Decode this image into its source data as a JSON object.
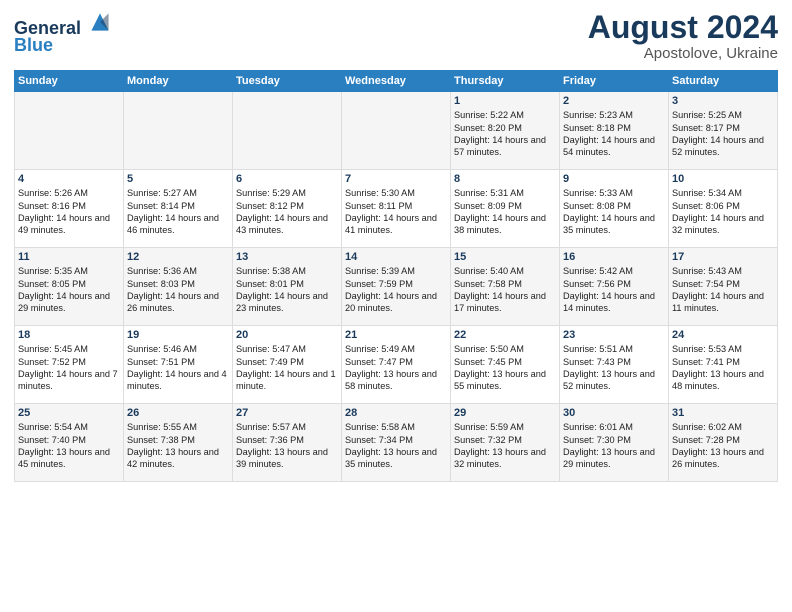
{
  "header": {
    "logo_line1": "General",
    "logo_line2": "Blue",
    "month": "August 2024",
    "location": "Apostolove, Ukraine"
  },
  "days_of_week": [
    "Sunday",
    "Monday",
    "Tuesday",
    "Wednesday",
    "Thursday",
    "Friday",
    "Saturday"
  ],
  "weeks": [
    [
      {
        "day": "",
        "content": ""
      },
      {
        "day": "",
        "content": ""
      },
      {
        "day": "",
        "content": ""
      },
      {
        "day": "",
        "content": ""
      },
      {
        "day": "1",
        "content": "Sunrise: 5:22 AM\nSunset: 8:20 PM\nDaylight: 14 hours\nand 57 minutes."
      },
      {
        "day": "2",
        "content": "Sunrise: 5:23 AM\nSunset: 8:18 PM\nDaylight: 14 hours\nand 54 minutes."
      },
      {
        "day": "3",
        "content": "Sunrise: 5:25 AM\nSunset: 8:17 PM\nDaylight: 14 hours\nand 52 minutes."
      }
    ],
    [
      {
        "day": "4",
        "content": "Sunrise: 5:26 AM\nSunset: 8:16 PM\nDaylight: 14 hours\nand 49 minutes."
      },
      {
        "day": "5",
        "content": "Sunrise: 5:27 AM\nSunset: 8:14 PM\nDaylight: 14 hours\nand 46 minutes."
      },
      {
        "day": "6",
        "content": "Sunrise: 5:29 AM\nSunset: 8:12 PM\nDaylight: 14 hours\nand 43 minutes."
      },
      {
        "day": "7",
        "content": "Sunrise: 5:30 AM\nSunset: 8:11 PM\nDaylight: 14 hours\nand 41 minutes."
      },
      {
        "day": "8",
        "content": "Sunrise: 5:31 AM\nSunset: 8:09 PM\nDaylight: 14 hours\nand 38 minutes."
      },
      {
        "day": "9",
        "content": "Sunrise: 5:33 AM\nSunset: 8:08 PM\nDaylight: 14 hours\nand 35 minutes."
      },
      {
        "day": "10",
        "content": "Sunrise: 5:34 AM\nSunset: 8:06 PM\nDaylight: 14 hours\nand 32 minutes."
      }
    ],
    [
      {
        "day": "11",
        "content": "Sunrise: 5:35 AM\nSunset: 8:05 PM\nDaylight: 14 hours\nand 29 minutes."
      },
      {
        "day": "12",
        "content": "Sunrise: 5:36 AM\nSunset: 8:03 PM\nDaylight: 14 hours\nand 26 minutes."
      },
      {
        "day": "13",
        "content": "Sunrise: 5:38 AM\nSunset: 8:01 PM\nDaylight: 14 hours\nand 23 minutes."
      },
      {
        "day": "14",
        "content": "Sunrise: 5:39 AM\nSunset: 7:59 PM\nDaylight: 14 hours\nand 20 minutes."
      },
      {
        "day": "15",
        "content": "Sunrise: 5:40 AM\nSunset: 7:58 PM\nDaylight: 14 hours\nand 17 minutes."
      },
      {
        "day": "16",
        "content": "Sunrise: 5:42 AM\nSunset: 7:56 PM\nDaylight: 14 hours\nand 14 minutes."
      },
      {
        "day": "17",
        "content": "Sunrise: 5:43 AM\nSunset: 7:54 PM\nDaylight: 14 hours\nand 11 minutes."
      }
    ],
    [
      {
        "day": "18",
        "content": "Sunrise: 5:45 AM\nSunset: 7:52 PM\nDaylight: 14 hours\nand 7 minutes."
      },
      {
        "day": "19",
        "content": "Sunrise: 5:46 AM\nSunset: 7:51 PM\nDaylight: 14 hours\nand 4 minutes."
      },
      {
        "day": "20",
        "content": "Sunrise: 5:47 AM\nSunset: 7:49 PM\nDaylight: 14 hours\nand 1 minute."
      },
      {
        "day": "21",
        "content": "Sunrise: 5:49 AM\nSunset: 7:47 PM\nDaylight: 13 hours\nand 58 minutes."
      },
      {
        "day": "22",
        "content": "Sunrise: 5:50 AM\nSunset: 7:45 PM\nDaylight: 13 hours\nand 55 minutes."
      },
      {
        "day": "23",
        "content": "Sunrise: 5:51 AM\nSunset: 7:43 PM\nDaylight: 13 hours\nand 52 minutes."
      },
      {
        "day": "24",
        "content": "Sunrise: 5:53 AM\nSunset: 7:41 PM\nDaylight: 13 hours\nand 48 minutes."
      }
    ],
    [
      {
        "day": "25",
        "content": "Sunrise: 5:54 AM\nSunset: 7:40 PM\nDaylight: 13 hours\nand 45 minutes."
      },
      {
        "day": "26",
        "content": "Sunrise: 5:55 AM\nSunset: 7:38 PM\nDaylight: 13 hours\nand 42 minutes."
      },
      {
        "day": "27",
        "content": "Sunrise: 5:57 AM\nSunset: 7:36 PM\nDaylight: 13 hours\nand 39 minutes."
      },
      {
        "day": "28",
        "content": "Sunrise: 5:58 AM\nSunset: 7:34 PM\nDaylight: 13 hours\nand 35 minutes."
      },
      {
        "day": "29",
        "content": "Sunrise: 5:59 AM\nSunset: 7:32 PM\nDaylight: 13 hours\nand 32 minutes."
      },
      {
        "day": "30",
        "content": "Sunrise: 6:01 AM\nSunset: 7:30 PM\nDaylight: 13 hours\nand 29 minutes."
      },
      {
        "day": "31",
        "content": "Sunrise: 6:02 AM\nSunset: 7:28 PM\nDaylight: 13 hours\nand 26 minutes."
      }
    ]
  ]
}
